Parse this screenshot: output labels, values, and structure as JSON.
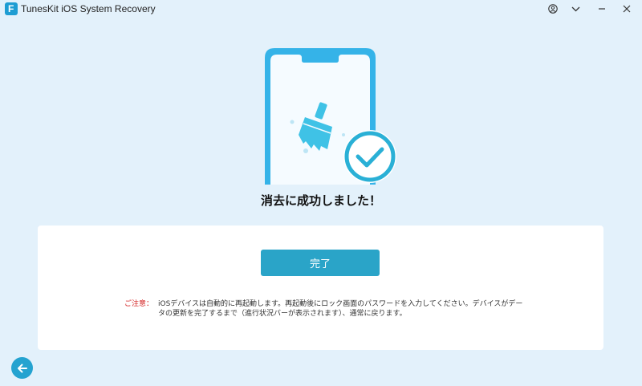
{
  "window": {
    "title": "TunesKit iOS System Recovery",
    "logo_letter": "F",
    "controls": [
      "account-icon",
      "chevron-down-icon",
      "minimize-icon",
      "close-icon"
    ]
  },
  "illustration": {
    "icons": [
      "phone-icon",
      "broom-icon",
      "check-circle-icon"
    ],
    "colors": {
      "phone_frame": "#35b3e8",
      "broom": "#3fc2e6",
      "check": "#2ab0d6"
    }
  },
  "status": {
    "title": "消去に成功しました！"
  },
  "card": {
    "done_button": "完了",
    "notice_label": "ご注意：",
    "notice_text": "iOSデバイスは自動的に再起動します。再起動後にロック画面のパスワードを入力してください。デバイスがデータの更新を完了するまで（進行状況バーが表示されます）、通常に戻ります。"
  },
  "footer": {
    "back_icon": "arrow-left-icon"
  },
  "colors": {
    "background": "#e3f1fb",
    "accent": "#2aa4c8",
    "warning": "#d32222"
  }
}
